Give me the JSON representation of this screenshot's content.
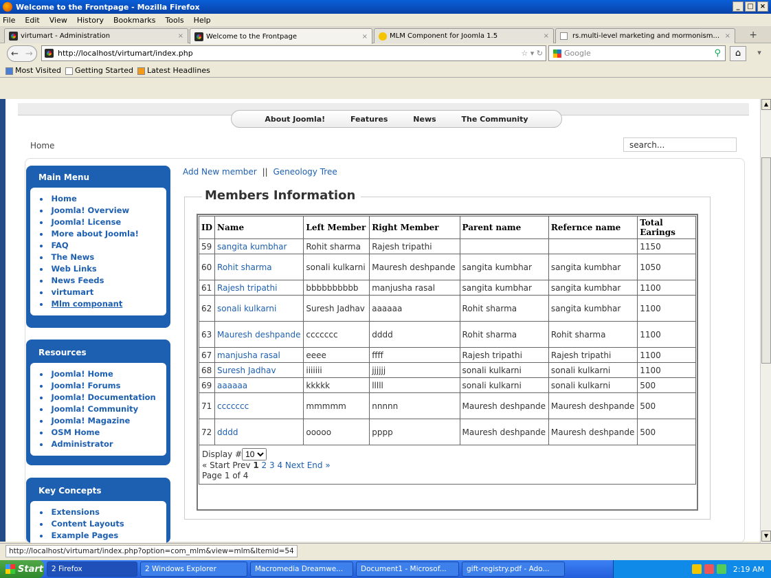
{
  "window": {
    "title": "Welcome to the Frontpage - Mozilla Firefox"
  },
  "menubar": {
    "items": [
      "File",
      "Edit",
      "View",
      "History",
      "Bookmarks",
      "Tools",
      "Help"
    ]
  },
  "tabs": [
    {
      "label": "virtumart - Administration"
    },
    {
      "label": "Welcome to the Frontpage"
    },
    {
      "label": "MLM Component for Joomla 1.5"
    },
    {
      "label": "rs.multi-level marketing and mormonism..."
    }
  ],
  "nav": {
    "url": "http://localhost/virtumart/index.php",
    "search_engine": "Google"
  },
  "bookmarks": [
    "Most Visited",
    "Getting Started",
    "Latest Headlines"
  ],
  "site": {
    "top_menu": [
      "About Joomla!",
      "Features",
      "News",
      "The Community"
    ],
    "breadcrumb": "Home",
    "search_placeholder": "search...",
    "main_menu": {
      "title": "Main Menu",
      "items": [
        "Home",
        "Joomla! Overview",
        "Joomla! License",
        "More about Joomla!",
        "FAQ",
        "The News",
        "Web Links",
        "News Feeds",
        "virtumart",
        "Mlm componant"
      ]
    },
    "resources": {
      "title": "Resources",
      "items": [
        "Joomla! Home",
        "Joomla! Forums",
        "Joomla! Documentation",
        "Joomla! Community",
        "Joomla! Magazine",
        "OSM Home",
        "Administrator"
      ]
    },
    "key_concepts": {
      "title": "Key Concepts",
      "items": [
        "Extensions",
        "Content Layouts",
        "Example Pages"
      ]
    },
    "links": {
      "add": "Add New member",
      "sep": "||",
      "tree": "Geneology Tree"
    },
    "section_title": "Members Information",
    "table": {
      "headers": [
        "ID",
        "Name",
        "Left Member",
        "Right Member",
        "Parent name",
        "Refernce name",
        "Total Earings"
      ],
      "rows": [
        [
          "59",
          "sangita kumbhar",
          "Rohit sharma",
          "Rajesh tripathi",
          "",
          "",
          "1150"
        ],
        [
          "60",
          "Rohit sharma",
          "sonali kulkarni",
          "Mauresh deshpande",
          "sangita kumbhar",
          "sangita kumbhar",
          "1050"
        ],
        [
          "61",
          "Rajesh tripathi",
          "bbbbbbbbbb",
          "manjusha rasal",
          "sangita kumbhar",
          "sangita kumbhar",
          "1100"
        ],
        [
          "62",
          "sonali kulkarni",
          "Suresh Jadhav",
          "aaaaaa",
          "Rohit sharma",
          "sangita kumbhar",
          "1100"
        ],
        [
          "63",
          "Mauresh deshpande",
          "ccccccc",
          "dddd",
          "Rohit sharma",
          "Rohit sharma",
          "1100"
        ],
        [
          "67",
          "manjusha rasal",
          "eeee",
          "ffff",
          "Rajesh tripathi",
          "Rajesh tripathi",
          "1100"
        ],
        [
          "68",
          "Suresh Jadhav",
          "iiiiiii",
          "jjjjjj",
          "sonali kulkarni",
          "sonali kulkarni",
          "1100"
        ],
        [
          "69",
          "aaaaaa",
          "kkkkk",
          "lllll",
          "sonali kulkarni",
          "sonali kulkarni",
          "500"
        ],
        [
          "71",
          "ccccccc",
          "mmmmm",
          "nnnnn",
          "Mauresh deshpande",
          "Mauresh deshpande",
          "500"
        ],
        [
          "72",
          "dddd",
          "ooooo",
          "pppp",
          "Mauresh deshpande",
          "Mauresh deshpande",
          "500"
        ]
      ]
    },
    "pager": {
      "display_label": "Display #",
      "display_value": "10",
      "start": "« Start",
      "prev": "Prev",
      "current": "1",
      "pages": [
        "2",
        "3",
        "4"
      ],
      "next": "Next",
      "end": "End »",
      "page_info": "Page 1 of 4"
    }
  },
  "statusbar": {
    "text": "http://localhost/virtumart/index.php?option=com_mlm&view=mlm&Itemid=54"
  },
  "taskbar": {
    "start": "Start",
    "tasks": [
      "2 Firefox",
      "2 Windows Explorer",
      "Macromedia Dreamwe...",
      "Document1 - Microsof...",
      "gift-registry.pdf - Ado..."
    ],
    "clock": "2:19 AM"
  }
}
